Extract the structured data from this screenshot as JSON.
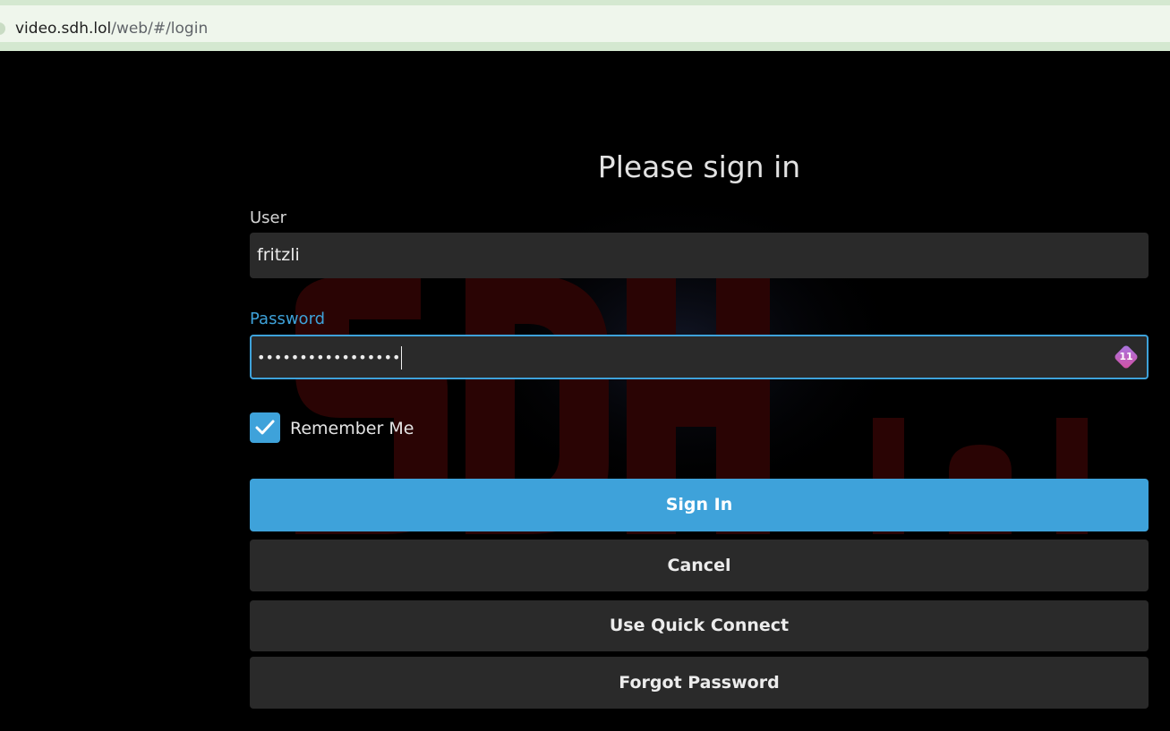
{
  "browser": {
    "url_host": "video.sdh.lol",
    "url_path": "/web/#/login"
  },
  "login": {
    "title": "Please sign in",
    "user_label": "User",
    "user_value": "fritzli",
    "password_label": "Password",
    "password_masked": "•••••••••••••••••",
    "password_manager_count": "11",
    "remember_label": "Remember Me",
    "remember_checked": true
  },
  "buttons": {
    "sign_in": "Sign In",
    "cancel": "Cancel",
    "quick_connect": "Use Quick Connect",
    "forgot_password": "Forgot Password"
  },
  "colors": {
    "accent": "#3ea2da",
    "field_bg": "#2a2a2a",
    "background": "#000000"
  },
  "icons": {
    "checkbox": "checkmark-icon",
    "password_manager": "password-manager-icon"
  }
}
